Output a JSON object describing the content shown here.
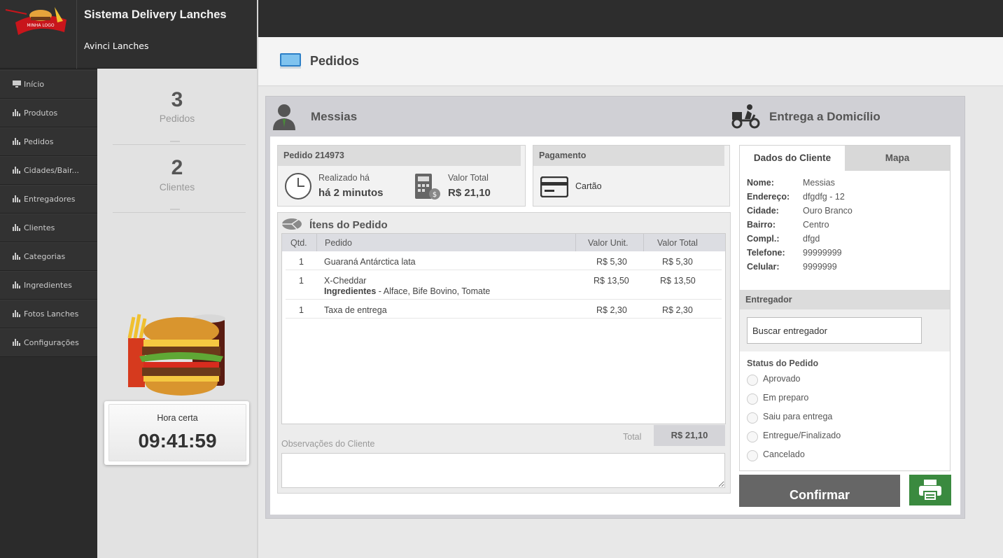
{
  "brand": {
    "title": "Sistema Delivery Lanches",
    "subtitle": "Avinci Lanches",
    "logo_text": "MINHA LOGO"
  },
  "sidebar": {
    "items": [
      {
        "label": "Início"
      },
      {
        "label": "Produtos"
      },
      {
        "label": "Pedidos"
      },
      {
        "label": "Cidades/Bair..."
      },
      {
        "label": "Entregadores"
      },
      {
        "label": "Clientes"
      },
      {
        "label": "Categorias"
      },
      {
        "label": "Ingredientes"
      },
      {
        "label": "Fotos Lanches"
      },
      {
        "label": "Configurações"
      }
    ]
  },
  "stats": {
    "pedidos_count": "3",
    "pedidos_label": "Pedidos",
    "clientes_count": "2",
    "clientes_label": "Clientes"
  },
  "clock": {
    "label": "Hora certa",
    "time": "09:41:59"
  },
  "page": {
    "title": "Pedidos"
  },
  "order": {
    "customer_name": "Messias",
    "delivery_type": "Entrega a Domicílio",
    "order_title": "Pedido 214973",
    "placed_label": "Realizado há",
    "placed_value": "há 2 minutos",
    "total_label": "Valor Total",
    "total_value": "R$ 21,10",
    "payment_title": "Pagamento",
    "payment_method": "Cartão",
    "items_title": "Ítens do Pedido",
    "columns": {
      "qtd": "Qtd.",
      "pedido": "Pedido",
      "unit": "Valor Unit.",
      "total": "Valor Total"
    },
    "items": [
      {
        "qtd": "1",
        "name": "Guaraná Antárctica lata",
        "ingredients_label": "",
        "ingredients": "",
        "unit": "R$ 5,30",
        "total": "R$ 5,30"
      },
      {
        "qtd": "1",
        "name": "X-Cheddar",
        "ingredients_label": "Ingredientes",
        "ingredients": " - Alface, Bife Bovino, Tomate",
        "unit": "R$ 13,50",
        "total": "R$ 13,50"
      },
      {
        "qtd": "1",
        "name": "Taxa de entrega",
        "ingredients_label": "",
        "ingredients": "",
        "unit": "R$ 2,30",
        "total": "R$ 2,30"
      }
    ],
    "sum_label": "Total",
    "sum_value": "R$ 21,10",
    "obs_label": "Observações do Cliente"
  },
  "client": {
    "tabs": {
      "dados": "Dados do Cliente",
      "mapa": "Mapa"
    },
    "fields": [
      {
        "k": "Nome:",
        "v": "Messias"
      },
      {
        "k": "Endereço:",
        "v": "dfgdfg - 12"
      },
      {
        "k": "Cidade:",
        "v": "Ouro Branco"
      },
      {
        "k": "Bairro:",
        "v": "Centro"
      },
      {
        "k": "Compl.:",
        "v": "dfgd"
      },
      {
        "k": "Telefone:",
        "v": "99999999"
      },
      {
        "k": "Celular:",
        "v": "9999999"
      }
    ],
    "entregador_title": "Entregador",
    "entregador_placeholder": "Buscar entregador",
    "status_title": "Status do Pedido",
    "status_options": [
      "Aprovado",
      "Em preparo",
      "Saiu para entrega",
      "Entregue/Finalizado",
      "Cancelado"
    ],
    "confirm_label": "Confirmar"
  },
  "colors": {
    "sidebar": "#2f2f2f",
    "confirm": "#666666",
    "print": "#3a8a3f"
  },
  "icons": {
    "monitor": "monitor-icon",
    "bars": "bar-chart-icon",
    "user": "user-icon",
    "delivery": "delivery-bike-icon",
    "clock": "clock-icon",
    "calculator": "calculator-icon",
    "card": "credit-card-icon",
    "pizza": "pizza-icon",
    "printer": "printer-icon"
  }
}
